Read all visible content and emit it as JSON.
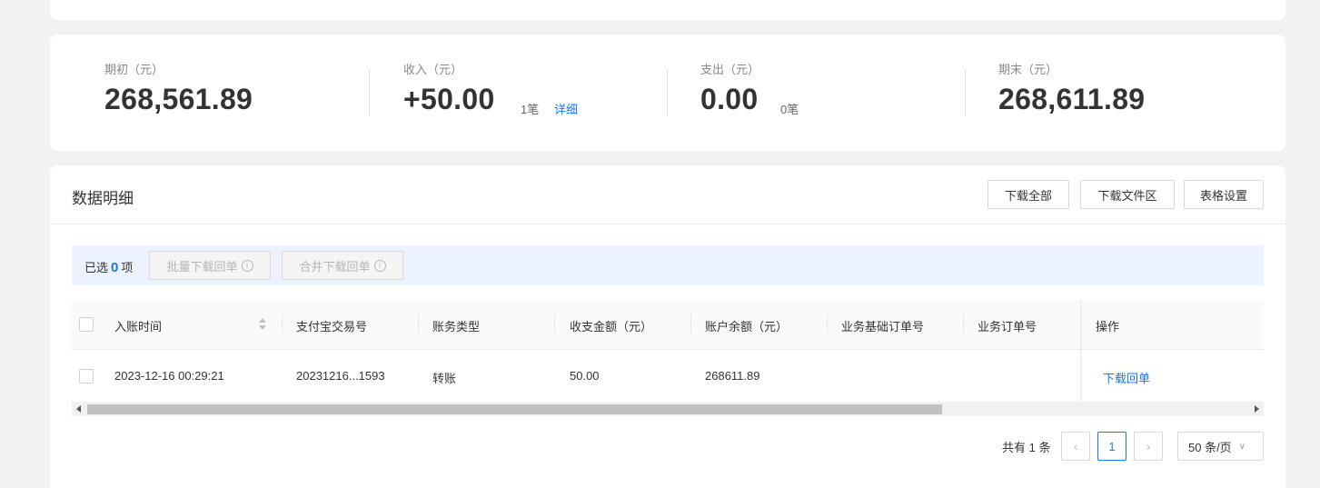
{
  "summary": {
    "opening": {
      "label": "期初（元）",
      "value": "268,561.89"
    },
    "income": {
      "label": "收入（元）",
      "value": "+50.00",
      "count": "1笔",
      "link": "详细"
    },
    "expense": {
      "label": "支出（元）",
      "value": "0.00",
      "count": "0笔"
    },
    "closing": {
      "label": "期末（元）",
      "value": "268,611.89"
    }
  },
  "detail": {
    "title": "数据明细",
    "buttons": {
      "download_all": "下载全部",
      "download_files": "下载文件区",
      "table_settings": "表格设置"
    },
    "selection": {
      "prefix": "已选",
      "count": "0",
      "suffix": "项",
      "batch_download": "批量下载回单",
      "merge_download": "合并下载回单"
    },
    "columns": [
      "入账时间",
      "支付宝交易号",
      "账务类型",
      "收支金额（元）",
      "账户余额（元）",
      "业务基础订单号",
      "业务订单号",
      "操作"
    ],
    "rows": [
      {
        "time": "2023-12-16 00:29:21",
        "trade_no": "20231216...1593",
        "type": "转账",
        "amount": "50.00",
        "balance": "268611.89",
        "base_order": "",
        "order": "",
        "action": "下载回单"
      }
    ],
    "pagination": {
      "total": "共有 1 条",
      "prev": "‹",
      "current": "1",
      "next": "›",
      "page_size": "50 条/页",
      "size_chevron": "∨"
    }
  },
  "icons": {
    "info": "i"
  }
}
